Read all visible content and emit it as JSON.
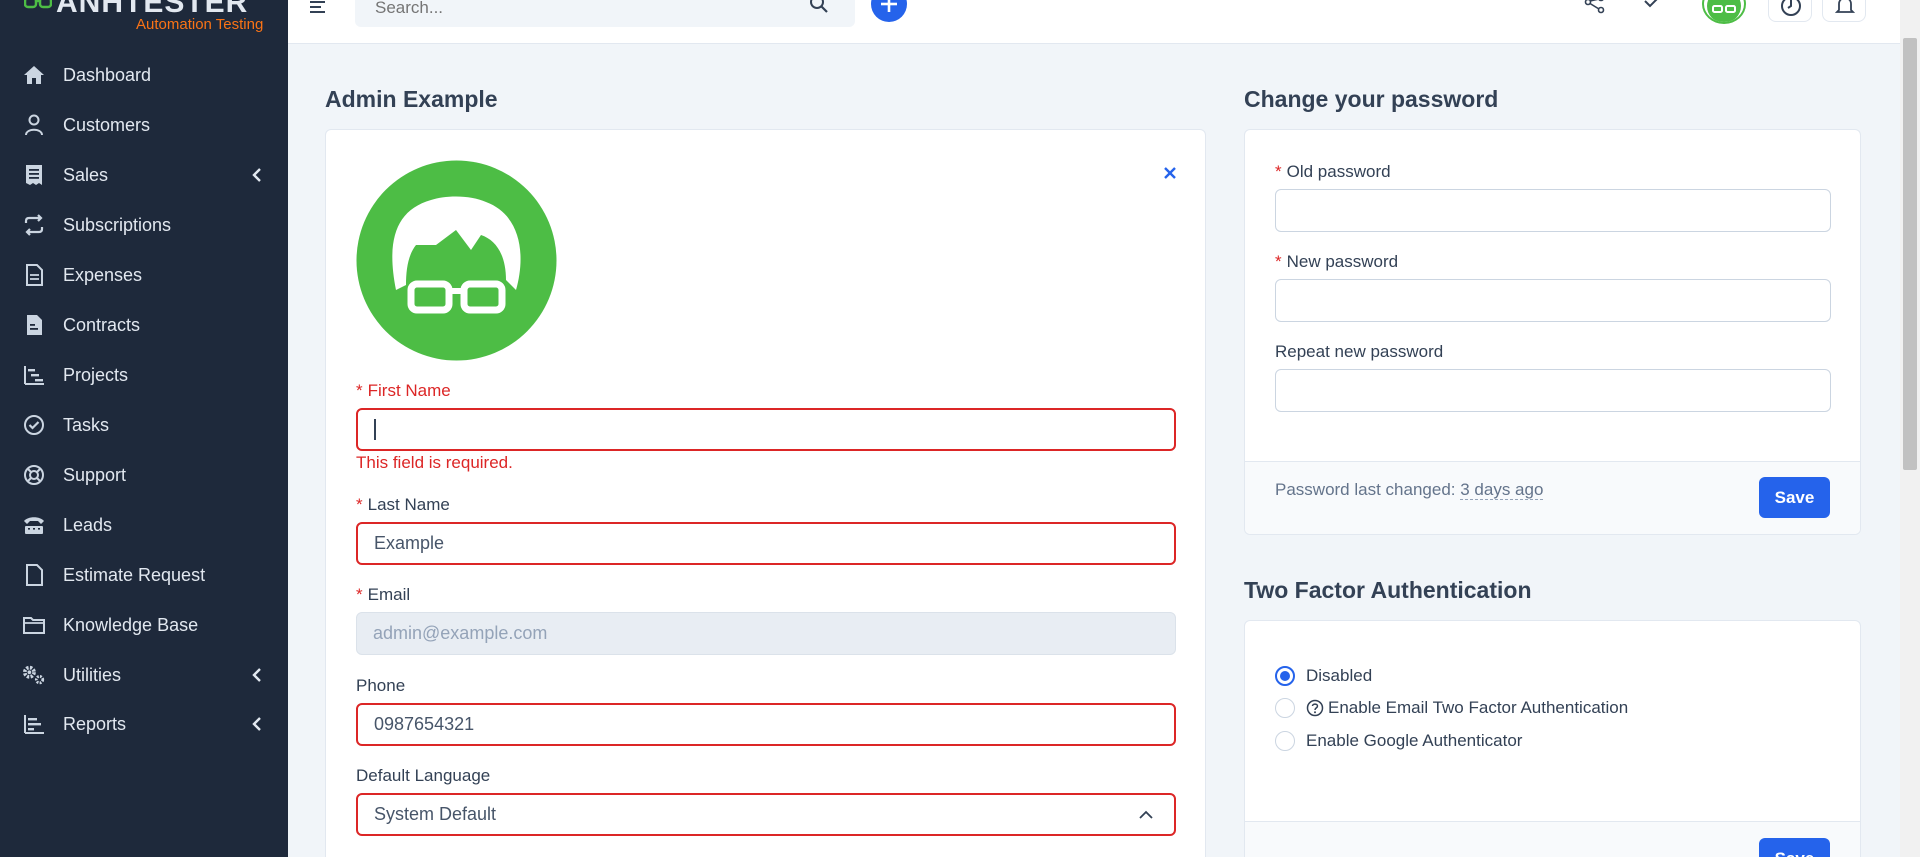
{
  "brand": {
    "name": "ANHTESTER",
    "tagline": "Automation Testing"
  },
  "sidebar": {
    "items": [
      {
        "label": "Dashboard",
        "icon": "home-icon",
        "has_submenu": false
      },
      {
        "label": "Customers",
        "icon": "user-icon",
        "has_submenu": false
      },
      {
        "label": "Sales",
        "icon": "receipt-icon",
        "has_submenu": true
      },
      {
        "label": "Subscriptions",
        "icon": "repeat-icon",
        "has_submenu": false
      },
      {
        "label": "Expenses",
        "icon": "document-icon",
        "has_submenu": false
      },
      {
        "label": "Contracts",
        "icon": "contract-icon",
        "has_submenu": false
      },
      {
        "label": "Projects",
        "icon": "projects-icon",
        "has_submenu": false
      },
      {
        "label": "Tasks",
        "icon": "check-circle-icon",
        "has_submenu": false
      },
      {
        "label": "Support",
        "icon": "lifebuoy-icon",
        "has_submenu": false
      },
      {
        "label": "Leads",
        "icon": "tty-icon",
        "has_submenu": false
      },
      {
        "label": "Estimate Request",
        "icon": "file-icon",
        "has_submenu": false
      },
      {
        "label": "Knowledge Base",
        "icon": "folder-icon",
        "has_submenu": false
      },
      {
        "label": "Utilities",
        "icon": "cogs-icon",
        "has_submenu": true
      },
      {
        "label": "Reports",
        "icon": "chart-icon",
        "has_submenu": true
      }
    ]
  },
  "topbar": {
    "search_placeholder": "Search..."
  },
  "profile": {
    "title": "Admin Example",
    "first_name": {
      "label": "First Name",
      "value": "",
      "error": "This field is required."
    },
    "last_name": {
      "label": "Last Name",
      "value": "Example"
    },
    "email": {
      "label": "Email",
      "value": "admin@example.com"
    },
    "phone": {
      "label": "Phone",
      "value": "0987654321"
    },
    "language": {
      "label": "Default Language",
      "value": "System Default"
    },
    "required_marker": "*"
  },
  "password": {
    "title": "Change your password",
    "old_label": "Old password",
    "new_label": "New password",
    "repeat_label": "Repeat new password",
    "last_changed_label": "Password last changed:",
    "last_changed_value": "3 days ago",
    "save_label": "Save"
  },
  "two_factor": {
    "title": "Two Factor Authentication",
    "options": [
      {
        "label": "Disabled",
        "checked": true
      },
      {
        "label": "Enable Email Two Factor Authentication",
        "checked": false
      },
      {
        "label": "Enable Google Authenticator",
        "checked": false
      }
    ],
    "save_label": "Save"
  },
  "colors": {
    "sidebar_bg": "#1e293b",
    "accent": "#2563eb",
    "error": "#dc2626",
    "avatar_green": "#4dbd45",
    "brand_orange": "#f97316"
  }
}
